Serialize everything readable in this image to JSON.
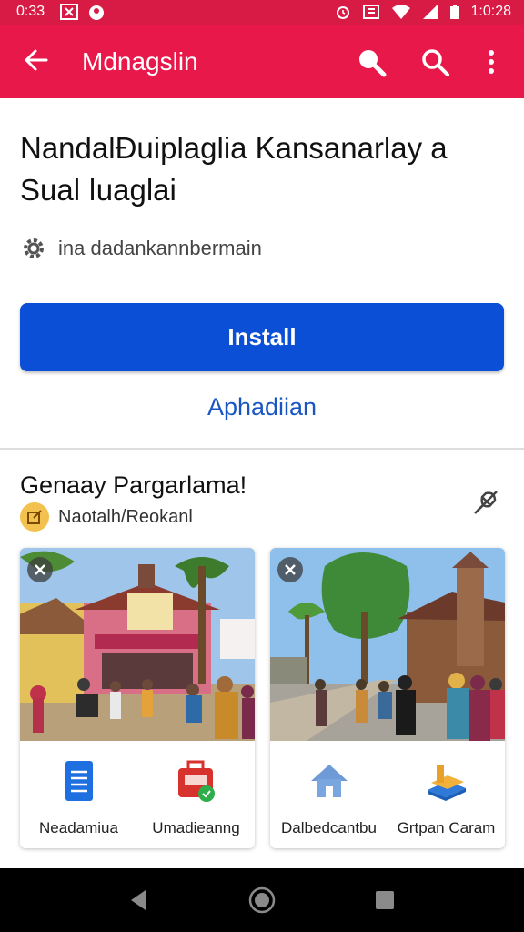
{
  "status_bar": {
    "time": "0:33",
    "right_time": "1:0:28",
    "icons": [
      "close-box-icon",
      "circle-icon",
      "alarm-icon",
      "nfc-icon",
      "wifi-icon",
      "signal-icon",
      "battery-icon"
    ]
  },
  "app_bar": {
    "title": "Mdnagslin",
    "colors": {
      "background": "#e8194a",
      "status": "#d81b45"
    },
    "actions": [
      "search-icon",
      "search-icon",
      "more-vert-icon"
    ]
  },
  "app": {
    "title": "NandalĐuiplaglia Kansanarlay a Sual ǀuaglai",
    "developer": "ina dadankannbermain",
    "install_label": "Install",
    "secondary_label": "Aphadiian",
    "colors": {
      "install": "#0b4fd6",
      "secondary": "#1a56c2"
    }
  },
  "section": {
    "title": "Genaay Pargarlama!",
    "subtitle": "Naotalh/Reokanl",
    "cards": [
      {
        "image": "town-square-photo",
        "tiles": [
          {
            "icon": "document-icon",
            "label": "Neadamiua"
          },
          {
            "icon": "toolbox-icon",
            "label": "Umadieanng"
          }
        ]
      },
      {
        "image": "village-street-photo",
        "tiles": [
          {
            "icon": "home-icon",
            "label": "Dalbedcantbu"
          },
          {
            "icon": "books-icon",
            "label": "Grtpan Caram"
          }
        ]
      }
    ]
  },
  "nav_bar": [
    "back-triangle-icon",
    "home-circle-icon",
    "recents-square-icon"
  ]
}
